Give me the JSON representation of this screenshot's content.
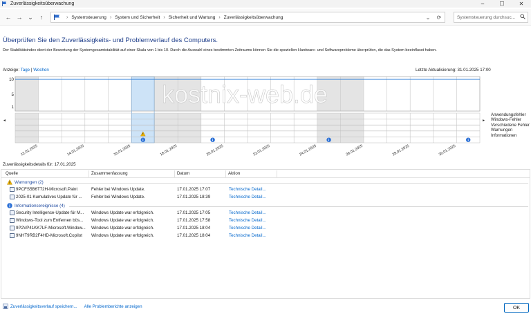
{
  "window": {
    "title": "Zuverlässigkeitsüberwachung",
    "minimize": "–",
    "maximize": "☐",
    "close": "✕"
  },
  "nav": {
    "back": "←",
    "forward": "→",
    "recent": "⌄",
    "up": "↑",
    "breadcrumb": [
      "Systemsteuerung",
      "System und Sicherheit",
      "Sicherheit und Wartung",
      "Zuverlässigkeitsüberwachung"
    ],
    "breadcrumb_sep": "›",
    "dropdown": "⌄",
    "refresh": "⟳",
    "search_placeholder": "Systemsteuerung durchsuc..."
  },
  "page": {
    "heading": "Überprüfen Sie den Zuverlässigkeits- und Problemverlauf des Computers.",
    "description": "Der Stabilitätsindex dient der Bewertung der Systemgesamtstabilität auf einer Skala von 1 bis 10. Durch die Auswahl eines bestimmten Zeitraums können Sie die speziellen Hardware- und Softwareprobleme überprüfen, die das System beeinflusst haben.",
    "view_label": "Anzeige:",
    "view_days": "Tage",
    "view_sep": "|",
    "view_weeks": "Wochen",
    "last_update": "Letzte Aktualisierung: 31.01.2025 17:00",
    "details_title": "Zuverlässigkeitsdetails für: 17.01.2025",
    "watermark": "kostnix-web.de"
  },
  "chart_data": {
    "type": "stability-index",
    "y_ticks": [
      "10",
      "5",
      "1"
    ],
    "ylim": [
      1,
      10
    ],
    "dates_shown": [
      "12.01.2025",
      "14.01.2025",
      "16.01.2025",
      "18.01.2025",
      "20.01.2025",
      "22.01.2025",
      "24.01.2025",
      "26.01.2025",
      "28.01.2025",
      "30.01.2025"
    ],
    "selected_date": "17.01.2025",
    "event_rows": [
      "Anwendungsfehler",
      "Windows-Fehler",
      "Verschiedene Fehler",
      "Warnungen",
      "Informationen"
    ],
    "events": [
      {
        "date": "17.01.2025",
        "type": "Warnungen"
      },
      {
        "date": "17.01.2025",
        "type": "Informationen"
      },
      {
        "date": "20.01.2025",
        "type": "Informationen"
      },
      {
        "date": "25.01.2025",
        "type": "Informationen"
      },
      {
        "date": "31.01.2025",
        "type": "Informationen"
      }
    ],
    "scroll_left": "◂",
    "scroll_right": "▸"
  },
  "table": {
    "headers": [
      "Quelle",
      "Zusammenfassung",
      "Datum",
      "Aktion"
    ],
    "groups": [
      {
        "label": "Warnungen (2)",
        "rows": [
          {
            "source": "9PCFS5B6T72H-Microsoft.Paint",
            "summary": "Fehler bei Windows Update.",
            "date": "17.01.2025 17:07",
            "action": "Technische Detail..."
          },
          {
            "source": "2025-01 Kumulatives Update für ...",
            "summary": "Fehler bei Windows Update.",
            "date": "17.01.2025 18:39",
            "action": "Technische Detail..."
          }
        ]
      },
      {
        "label": "Informationsereignisse (4)",
        "rows": [
          {
            "source": "Security Intelligence-Update für M...",
            "summary": "Windows Update war erfolgreich.",
            "date": "17.01.2025 17:05",
            "action": "Technische Detail..."
          },
          {
            "source": "Windows-Tool zum Entfernen bös...",
            "summary": "Windows Update war erfolgreich.",
            "date": "17.01.2025 17:58",
            "action": "Technische Detail..."
          },
          {
            "source": "9P2VP41KK7LF-Microsoft.Window...",
            "summary": "Windows Update war erfolgreich.",
            "date": "17.01.2025 18:04",
            "action": "Technische Detail..."
          },
          {
            "source": "9NHT9RB2F4HD-Microsoft.Copilot",
            "summary": "Windows Update war erfolgreich.",
            "date": "17.01.2025 18:04",
            "action": "Technische Detail..."
          }
        ]
      }
    ]
  },
  "footer": {
    "save_history": "Zuverlässigkeitsverlauf speichern...",
    "all_reports": "Alle Problemberichte anzeigen",
    "ok": "OK"
  },
  "colors": {
    "accent": "#0066cc",
    "heading": "#1e3e8a",
    "selected_column": "#cde3f7",
    "stability_line": "#2f7fd8"
  }
}
